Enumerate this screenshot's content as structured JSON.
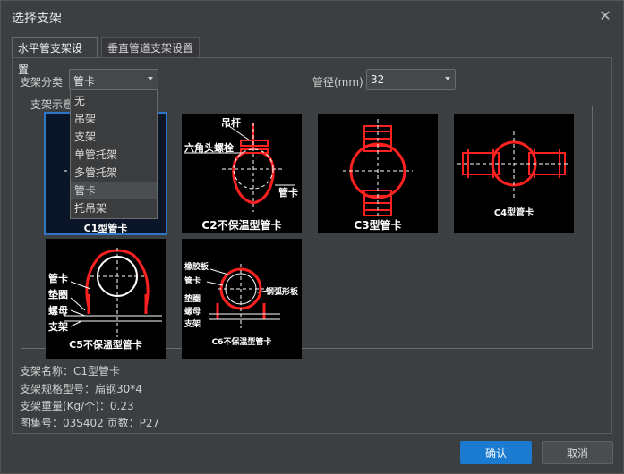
{
  "window": {
    "title": "选择支架"
  },
  "tabs": [
    {
      "label": "水平管支架设置",
      "active": true
    },
    {
      "label": "垂直管道支架设置",
      "active": false
    }
  ],
  "category": {
    "label": "支架分类",
    "value": "管卡"
  },
  "pipe": {
    "label": "管径(mm)",
    "value": "32"
  },
  "group": {
    "title": "支架示意"
  },
  "dropdown": {
    "options": [
      "无",
      "吊架",
      "支架",
      "单管托架",
      "多管托架",
      "管卡",
      "托吊架"
    ],
    "highlighted": "管卡"
  },
  "thumbs": [
    {
      "caption": "C1型管卡",
      "selected": true
    },
    {
      "caption": "C2不保温型管卡",
      "labels": [
        "吊杆",
        "六角头螺栓",
        "管卡"
      ]
    },
    {
      "caption": "C3型管卡"
    },
    {
      "caption": "C4型管卡"
    },
    {
      "caption": "C5不保温型管卡",
      "labels": [
        "管卡",
        "垫圈",
        "螺母",
        "支架"
      ]
    },
    {
      "caption": "C6不保温型管卡",
      "labels": [
        "橡胶板",
        "管卡",
        "钢弧形板",
        "垫圈",
        "螺母",
        "支架"
      ]
    }
  ],
  "info": {
    "name": "支架名称：C1型管卡",
    "spec": "支架规格型号：扁钢30*4",
    "weight": "支架重量(Kg/个)：0.23",
    "atlas": "图集号：03S402  页数：P27"
  },
  "buttons": {
    "ok": "确认",
    "cancel": "取消"
  },
  "colors": {
    "accent": "#1a7bd0",
    "drawing_red": "#ff2020",
    "selection": "#2f76c4"
  }
}
